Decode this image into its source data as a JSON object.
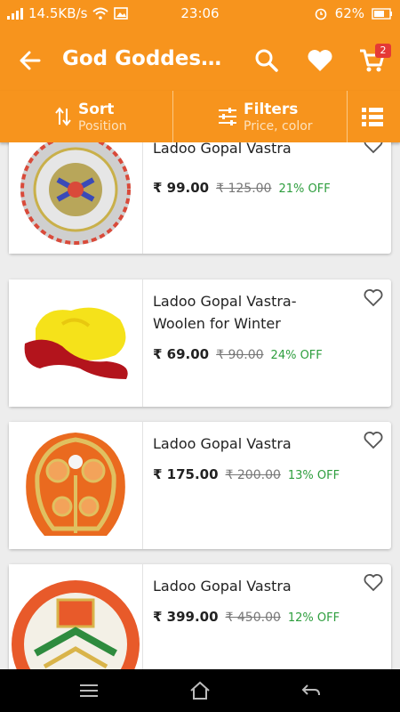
{
  "status_bar": {
    "net_speed": "14.5KB/s",
    "time": "23:06",
    "battery": "62%"
  },
  "toolbar": {
    "title": "God Goddess ...",
    "cart_count": "2"
  },
  "sortbar": {
    "sort_label": "Sort",
    "sort_sub": "Position",
    "filter_label": "Filters",
    "filter_sub": "Price, color"
  },
  "products": [
    {
      "name": "Ladoo Gopal Vastra",
      "price": "₹ 99.00",
      "mrp": "₹ 125.00",
      "off": "21% OFF"
    },
    {
      "name": "Ladoo Gopal Vastra- Woolen for Winter",
      "price": "₹ 69.00",
      "mrp": "₹ 90.00",
      "off": "24% OFF"
    },
    {
      "name": "Ladoo Gopal Vastra",
      "price": "₹ 175.00",
      "mrp": "₹ 200.00",
      "off": "13% OFF"
    },
    {
      "name": "Ladoo Gopal Vastra",
      "price": "₹ 399.00",
      "mrp": "₹ 450.00",
      "off": "12% OFF"
    }
  ],
  "colors": {
    "brand": "#f7941d",
    "discount": "#2e9e3e",
    "badge": "#e53935"
  }
}
